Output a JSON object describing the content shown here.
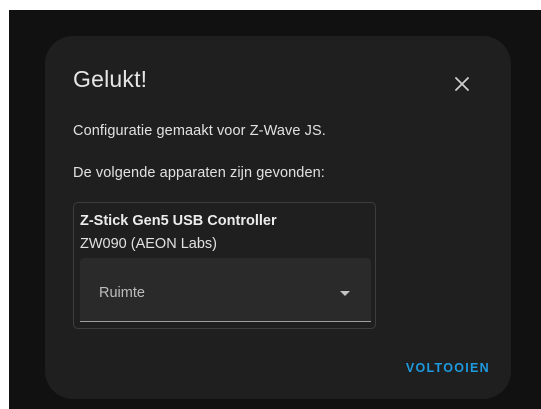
{
  "dialog": {
    "title": "Gelukt!",
    "close_icon": "close-icon",
    "message": "Configuratie gemaakt voor Z-Wave JS.",
    "devices_found_label": "De volgende apparaten zijn gevonden:",
    "device": {
      "name": "Z-Stick Gen5 USB Controller",
      "model": "ZW090 (AEON Labs)",
      "area_select": {
        "label": "Ruimte",
        "icon": "chevron-down-icon"
      }
    },
    "finish_button_label": "VOLTOOIEN",
    "colors": {
      "backdrop": "#111111",
      "surface": "#1f1f1f",
      "accent": "#1e9ae0"
    }
  }
}
